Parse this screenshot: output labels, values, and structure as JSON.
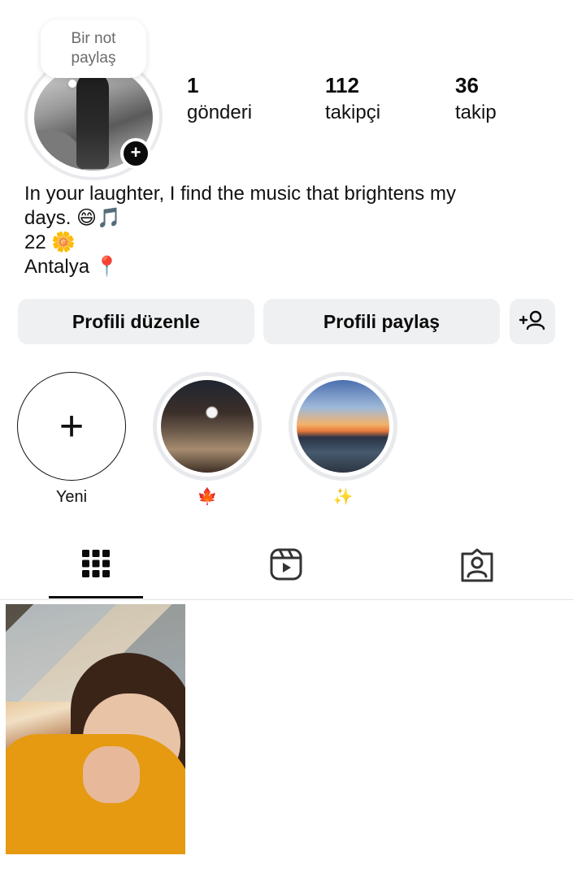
{
  "note": {
    "text": "Bir not\npaylaş"
  },
  "stats": [
    {
      "value": "1",
      "label": "gönderi"
    },
    {
      "value": "112",
      "label": "takipçi"
    },
    {
      "value": "36",
      "label": "takip"
    }
  ],
  "bio": {
    "line1": "In your laughter, I find the music that brightens my",
    "line2": "days. 😄🎵",
    "line3": "22 🌼",
    "line4": "Antalya 📍"
  },
  "buttons": {
    "edit_profile": "Profili düzenle",
    "share_profile": "Profili paylaş",
    "discover_people_icon": "person-add-icon"
  },
  "highlights": [
    {
      "caption": "Yeni",
      "kind": "new"
    },
    {
      "caption": "🍁",
      "kind": "story"
    },
    {
      "caption": "✨",
      "kind": "story"
    }
  ],
  "tabs": [
    {
      "name": "grid-icon",
      "active": true
    },
    {
      "name": "reels-icon",
      "active": false
    },
    {
      "name": "tagged-icon",
      "active": false
    }
  ],
  "colors": {
    "button_bg": "#eff0f2",
    "text": "#0b0b0b",
    "muted": "#6b6b6b"
  }
}
